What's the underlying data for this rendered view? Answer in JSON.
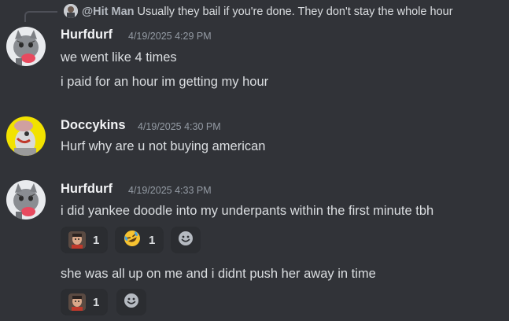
{
  "reply": {
    "author": "@Hit Man",
    "text": "Usually they bail if you're done. They don't stay the whole hour"
  },
  "messages": [
    {
      "author": "Hurfdurf",
      "timestamp": "4/19/2025 4:29 PM",
      "lines": [
        "we went like 4 times",
        "i paid for an hour im getting my hour"
      ]
    },
    {
      "author": "Doccykins",
      "timestamp": "4/19/2025 4:30 PM",
      "lines": [
        "Hurf why are u not buying american"
      ]
    },
    {
      "author": "Hurfdurf",
      "timestamp": "4/19/2025 4:33 PM",
      "lines": [
        "i did yankee doodle into my underpants within the first minute tbh"
      ],
      "reactions": [
        {
          "emoji": "custom-face-emoji",
          "count": "1"
        },
        {
          "emoji": "rofl-emoji",
          "count": "1"
        }
      ],
      "followup": {
        "text": "she was all up on me and i didnt push her away in time",
        "reactions": [
          {
            "emoji": "custom-face-emoji",
            "count": "1"
          }
        ]
      }
    }
  ],
  "colors": {
    "background": "#313338",
    "reaction_bg": "#2b2d31",
    "username": "#f2f3f5",
    "timestamp": "#949ba4",
    "message_text": "#dbdee1"
  }
}
